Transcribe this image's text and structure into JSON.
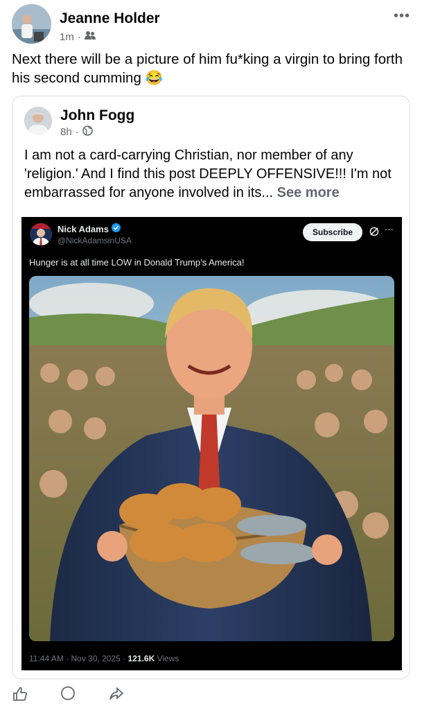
{
  "post": {
    "author": "Jeanne Holder",
    "time": "1m",
    "separator": "·",
    "audience_icon": "friends-icon",
    "more_icon": "more-dots-icon",
    "more_text": "•••",
    "text": "Next there will be a picture of him fu*king a virgin to bring forth his second cumming",
    "emoji": "😂"
  },
  "shared": {
    "author": "John Fogg",
    "time": "8h",
    "separator": "·",
    "audience_icon": "globe-icon",
    "text": "I am not a card-carrying Christian, nor member of any 'religion.' And I find this post DEEPLY OFFENSIVE!!! I'm not embarrassed for anyone involved in its...",
    "see_more": "See more"
  },
  "tweet": {
    "name": "Nick Adams",
    "handle": "@NickAdamsinUSA",
    "subscribe_label": "Subscribe",
    "more_text": "···",
    "text": "Hunger is at all time LOW in Donald Trump’s America!",
    "time": "11:44 AM · Nov 30, 2025 ·",
    "views_count": "121.6K",
    "views_label": "Views"
  },
  "colors": {
    "verified": "#1d9bf0",
    "muted": "#65676b",
    "tweet_bg": "#000000"
  }
}
